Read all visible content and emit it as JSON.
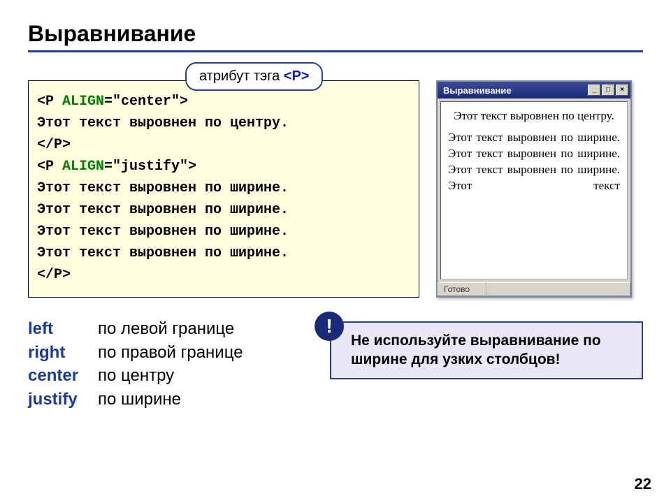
{
  "title": "Выравнивание",
  "callout": {
    "label": "атрибут тэга ",
    "tag": "<P>"
  },
  "code": {
    "l1a": "<P ",
    "l1b": "ALIGN",
    "l1c": "=\"center\">",
    "l2": "Этот текст выровнен по центру.",
    "l3": "</P>",
    "l4a": "<P ",
    "l4b": "ALIGN",
    "l4c": "=\"justify\">",
    "l5": "Этот текст выровнен по ширине.",
    "l6": "Этот текст выровнен по ширине.",
    "l7": "Этот текст выровнен по ширине.",
    "l8": "Этот текст выровнен по ширине.",
    "l9": "</P>"
  },
  "window": {
    "title": "Выравнивание",
    "btn_min": "_",
    "btn_max": "□",
    "btn_close": "×",
    "center_text": "Этот текст выровнен по центру.",
    "justify_text": "Этот текст выровнен по ширине. Этот текст выровнен по ширине. Этот текст выровнен по ширине. Этот текст",
    "status": "Готово"
  },
  "legend": {
    "items": [
      {
        "kw": "left",
        "desc": "по левой границе"
      },
      {
        "kw": "right",
        "desc": "по правой границе"
      },
      {
        "kw": "center",
        "desc": "по центру"
      },
      {
        "kw": "justify",
        "desc": "по ширине"
      }
    ]
  },
  "warning": {
    "badge": "!",
    "text": "Не используйте выравнивание по ширине для узких столбцов!"
  },
  "page": "22"
}
